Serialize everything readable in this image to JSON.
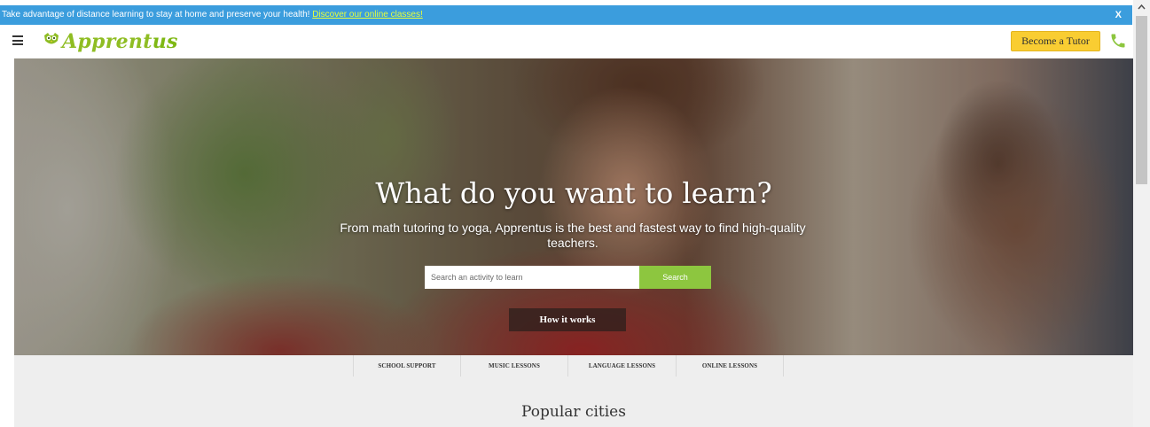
{
  "notice": {
    "text": "Take advantage of distance learning to stay at home and preserve your health! ",
    "link_text": "Discover our online classes!",
    "close_label": "X"
  },
  "header": {
    "logo_prefix": "Apprent",
    "logo_suffix": "us",
    "become_tutor_label": "Become a Tutor"
  },
  "hero": {
    "title": "What do you want to learn?",
    "subtitle": "From math tutoring to yoga, Apprentus is the best and fastest way to find high-quality teachers.",
    "search_placeholder": "Search an activity to learn",
    "search_button": "Search",
    "how_it_works": "How it works"
  },
  "categories": [
    {
      "label": "SCHOOL SUPPORT"
    },
    {
      "label": "MUSIC LESSONS"
    },
    {
      "label": "LANGUAGE LESSONS"
    },
    {
      "label": "ONLINE LESSONS"
    }
  ],
  "section": {
    "title": "Popular cities"
  },
  "colors": {
    "notice_bg": "#3b9ddd",
    "notice_link": "#e6ff3a",
    "brand_green": "#8dc63f",
    "tutor_button": "#f9cd32"
  },
  "icons": [
    "hamburger-menu-icon",
    "owl-logo-icon",
    "phone-icon",
    "scroll-up-arrow-icon"
  ]
}
